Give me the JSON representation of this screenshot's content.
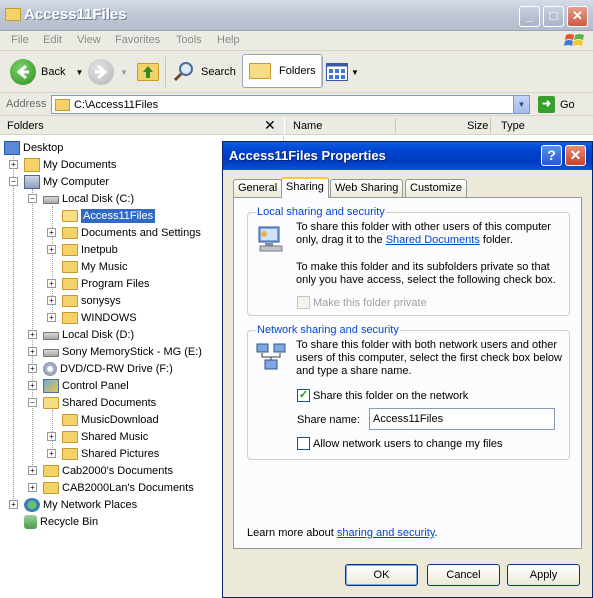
{
  "window": {
    "title": "Access11Files"
  },
  "menu": [
    "File",
    "Edit",
    "View",
    "Favorites",
    "Tools",
    "Help"
  ],
  "toolbar": {
    "back": "Back",
    "search": "Search",
    "folders": "Folders"
  },
  "address": {
    "label": "Address",
    "value": "C:\\Access11Files",
    "go": "Go"
  },
  "folders_pane": {
    "title": "Folders",
    "close": "✕",
    "tree": [
      {
        "label": "Desktop"
      },
      {
        "label": "My Documents"
      },
      {
        "label": "My Computer"
      },
      {
        "label": "Local Disk (C:)"
      },
      {
        "label": "Access11Files"
      },
      {
        "label": "Documents and Settings"
      },
      {
        "label": "Inetpub"
      },
      {
        "label": "My Music"
      },
      {
        "label": "Program Files"
      },
      {
        "label": "sonysys"
      },
      {
        "label": "WINDOWS"
      },
      {
        "label": "Local Disk (D:)"
      },
      {
        "label": "Sony MemoryStick - MG (E:)"
      },
      {
        "label": "DVD/CD-RW Drive (F:)"
      },
      {
        "label": "Control Panel"
      },
      {
        "label": "Shared Documents"
      },
      {
        "label": "MusicDownload"
      },
      {
        "label": "Shared Music"
      },
      {
        "label": "Shared Pictures"
      },
      {
        "label": "Cab2000's Documents"
      },
      {
        "label": "CAB2000Lan's Documents"
      },
      {
        "label": "My Network Places"
      },
      {
        "label": "Recycle Bin"
      }
    ]
  },
  "list_header": {
    "name": "Name",
    "size": "Size",
    "type": "Type"
  },
  "dialog": {
    "title": "Access11Files Properties",
    "help": "?",
    "close": "✕",
    "tabs": [
      "General",
      "Sharing",
      "Web Sharing",
      "Customize"
    ],
    "local": {
      "title": "Local sharing and security",
      "line1": "To share this folder with other users of this computer",
      "line2_pre": "only, drag it to the ",
      "line2_link": "Shared Documents",
      "line2_post": " folder.",
      "line3": "To make this folder and its subfolders private so that",
      "line4": "only you have access, select the following check box.",
      "private_label": "Make this folder private"
    },
    "network": {
      "title": "Network sharing and security",
      "line1": "To share this folder with both network users and other",
      "line2": "users of this computer, select the first check box below",
      "line3": "and type a share name.",
      "share_label": "Share this folder on the network",
      "share_name_label": "Share name:",
      "share_name_value": "Access11Files",
      "allow_label": "Allow network users to change my files"
    },
    "learn_pre": "Learn more about ",
    "learn_link": "sharing and security",
    "learn_post": ".",
    "buttons": {
      "ok": "OK",
      "cancel": "Cancel",
      "apply": "Apply"
    }
  }
}
